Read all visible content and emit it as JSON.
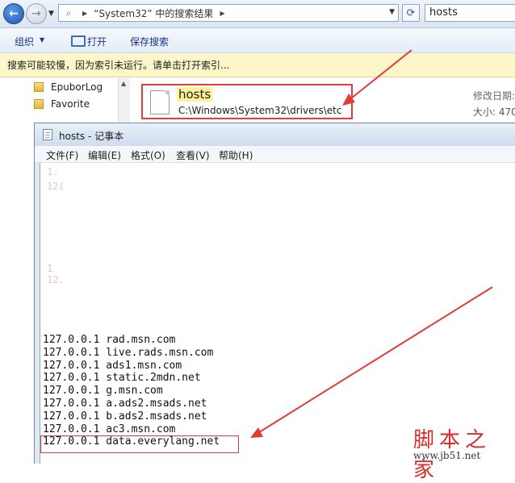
{
  "explorer": {
    "path": {
      "label": "“System32” 中的搜索结果"
    },
    "search": {
      "value": "hosts"
    },
    "toolbar": {
      "organize": "组织",
      "open": "打开",
      "save_search": "保存搜索"
    },
    "infobar": "搜索可能较慢，因为索引未运行。请单击打开索引...",
    "nav": [
      {
        "label": "EpuborLog"
      },
      {
        "label": "Favorite"
      }
    ],
    "result": {
      "name": "hosts",
      "path": "C:\\Windows\\System32\\drivers\\etc",
      "date_label": "修改日期:",
      "size_label": "大小: 470"
    }
  },
  "notepad": {
    "title": "hosts - 记事本",
    "menu": [
      "文件(F)",
      "编辑(E)",
      "格式(O)",
      "查看(V)",
      "帮助(H)"
    ],
    "lines": [
      "127.0.0.1 rad.msn.com",
      "127.0.0.1 live.rads.msn.com",
      "127.0.0.1 ads1.msn.com",
      "127.0.0.1 static.2mdn.net",
      "127.0.0.1 g.msn.com",
      "127.0.0.1 a.ads2.msads.net",
      "127.0.0.1 b.ads2.msads.net",
      "127.0.0.1 ac3.msn.com",
      "127.0.0.1 data.everylang.net"
    ]
  },
  "watermark": {
    "name": "脚本之家",
    "url": "www.jb51.net"
  },
  "colors": {
    "annotation": "#e23b3b",
    "highlight": "#fdf29a",
    "infobar": "#fcf6c8"
  }
}
